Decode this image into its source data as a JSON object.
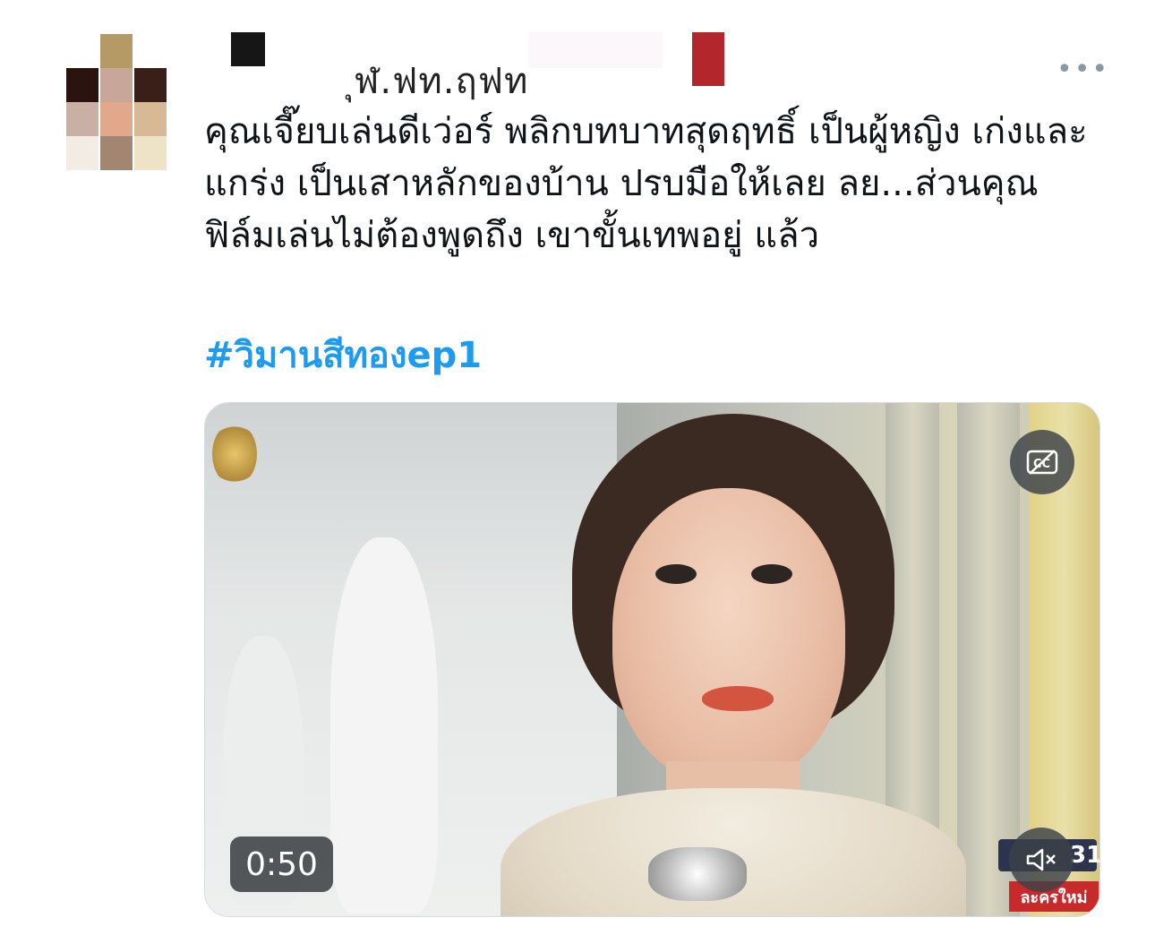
{
  "tweet": {
    "author_name_fragment": "ุฬ.ฟท.ฤฟท",
    "more_icon": "more-horizontal-icon",
    "text": "คุณเจี๊ยบเล่นดีเว่อร์ พลิกบทบาทสุดฤทธิ์ เป็นผู้หญิง เก่งและแกร่ง เป็นเสาหลักของบ้าน ปรบมือให้เลย ลย...ส่วนคุณฟิล์มเล่นไม่ต้องพูดถึง เขาขั้นเทพอยู่ แล้ว",
    "hashtag": "#วิมานสีทองep1"
  },
  "video": {
    "duration": "0:50",
    "captions_icon": "captions-off-icon",
    "mute_icon": "volume-muted-icon",
    "channel_number": "31",
    "channel_tag": "ละครใหม่"
  },
  "colors": {
    "hashtag": "#1d9bf0",
    "text": "#0f1419",
    "icon_gray": "#8a98a5"
  }
}
